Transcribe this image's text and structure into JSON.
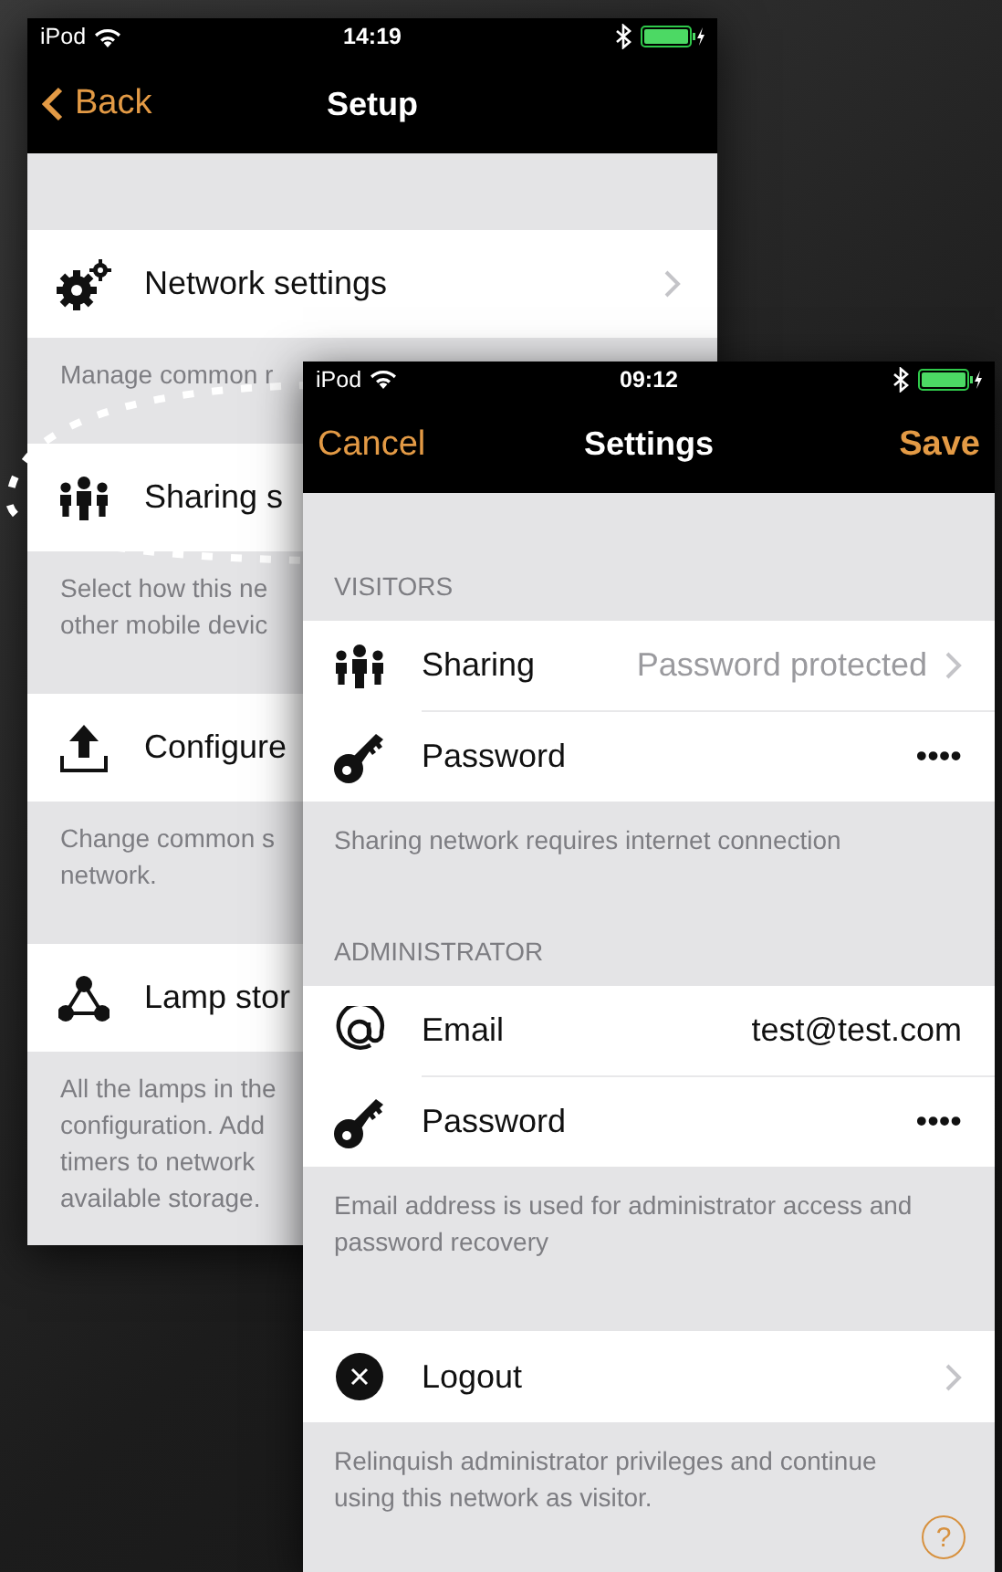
{
  "back_screen": {
    "status_bar": {
      "carrier": "iPod",
      "time": "14:19"
    },
    "nav": {
      "back": "Back",
      "title": "Setup"
    },
    "sections": [
      {
        "label": "Network settings",
        "footer_lines": [
          "Manage common r"
        ]
      },
      {
        "label": "Sharing s",
        "footer_lines": [
          "Select how this ne",
          "other mobile devic"
        ]
      },
      {
        "label": "Configure",
        "footer_lines": [
          "Change common s",
          "network."
        ]
      },
      {
        "label": "Lamp stor",
        "footer_lines": [
          "All the lamps in the",
          "configuration. Add",
          "timers to network",
          "available storage."
        ]
      }
    ]
  },
  "front_screen": {
    "status_bar": {
      "carrier": "iPod",
      "time": "09:12"
    },
    "nav": {
      "left": "Cancel",
      "title": "Settings",
      "right": "Save"
    },
    "groups": [
      {
        "header": "VISITORS",
        "rows": [
          {
            "label": "Sharing",
            "value": "Password protected",
            "muted": true,
            "chevron": true
          },
          {
            "label": "Password",
            "value": "••••",
            "muted": false,
            "chevron": false
          }
        ],
        "footer": "Sharing network requires internet connection"
      },
      {
        "header": "ADMINISTRATOR",
        "rows": [
          {
            "label": "Email",
            "value": "test@test.com",
            "muted": false,
            "chevron": false
          },
          {
            "label": "Password",
            "value": "••••",
            "muted": false,
            "chevron": false
          }
        ],
        "footer": "Email address is used for administrator access and password recovery"
      },
      {
        "rows": [
          {
            "label": "Logout",
            "chevron": true
          }
        ],
        "footer": "Relinquish administrator privileges and continue using this network as visitor."
      }
    ],
    "help": "?"
  }
}
